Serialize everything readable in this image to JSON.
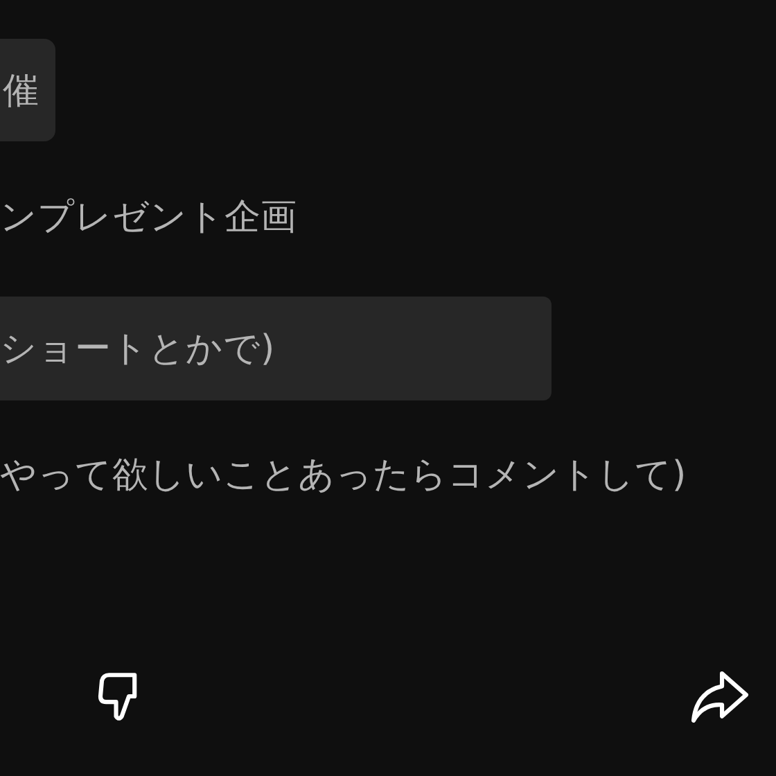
{
  "items": [
    {
      "kind": "chip",
      "text": "催"
    },
    {
      "kind": "line",
      "text": "ンプレゼント企画"
    },
    {
      "kind": "block",
      "text": "ショートとかで)"
    },
    {
      "kind": "line",
      "text": "やって欲しいことあったらコメントして)"
    }
  ],
  "actions": [
    {
      "kind": "dislike"
    },
    {
      "kind": "share"
    }
  ]
}
